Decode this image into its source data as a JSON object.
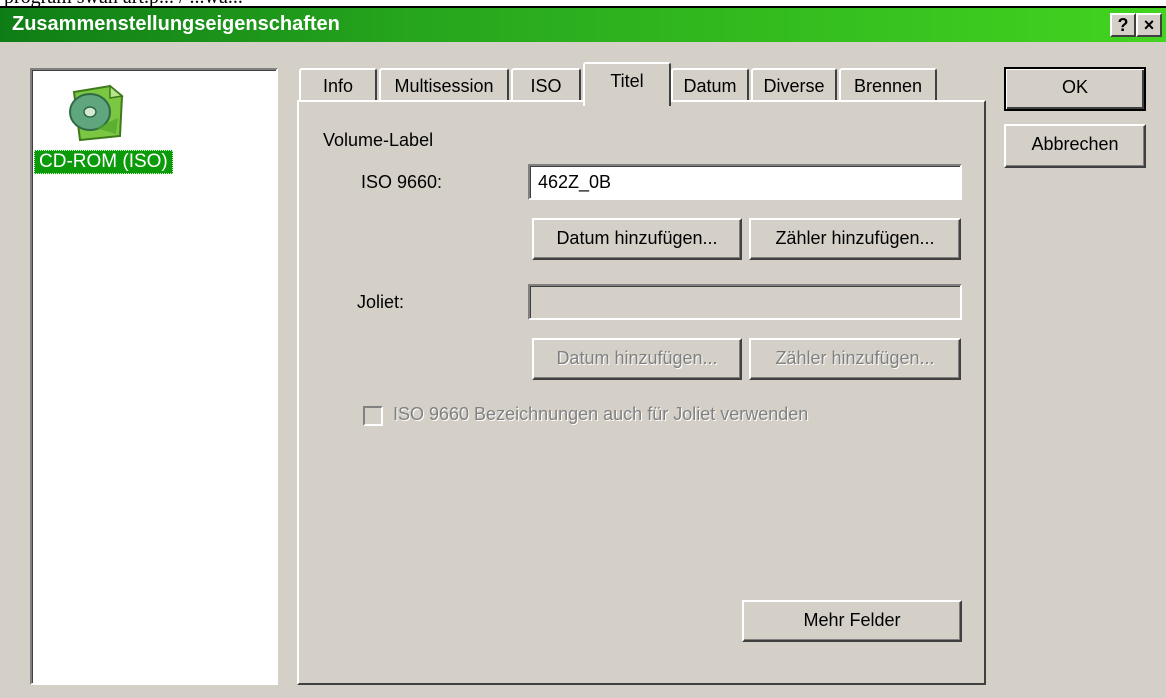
{
  "window": {
    "title": "Zusammenstellungseigenschaften",
    "help_button": "?",
    "close_button": "×",
    "leaked_text": "program swan art.p... / ...wa..."
  },
  "left_list": {
    "items": [
      {
        "label": "CD-ROM (ISO)",
        "icon": "cd-document-icon",
        "selected": true
      }
    ]
  },
  "tabs": [
    {
      "label": "Info"
    },
    {
      "label": "Multisession"
    },
    {
      "label": "ISO"
    },
    {
      "label": "Titel",
      "active": true
    },
    {
      "label": "Datum"
    },
    {
      "label": "Diverse"
    },
    {
      "label": "Brennen"
    }
  ],
  "titel_tab": {
    "group_label": "Volume-Label",
    "iso9660": {
      "label": "ISO 9660:",
      "value": "462Z_0B",
      "add_date": "Datum hinzufügen...",
      "add_counter": "Zähler hinzufügen..."
    },
    "joliet": {
      "label": "Joliet:",
      "value": "",
      "add_date": "Datum hinzufügen...",
      "add_counter": "Zähler hinzufügen..."
    },
    "checkbox_label": "ISO 9660 Bezeichnungen auch für Joliet verwenden",
    "more_fields": "Mehr Felder"
  },
  "buttons": {
    "ok": "OK",
    "cancel": "Abbrechen"
  },
  "colors": {
    "titlebar_start": "#0f7d16",
    "titlebar_end": "#42d420",
    "selection": "#0a9a0a",
    "face": "#d4d0c8"
  }
}
